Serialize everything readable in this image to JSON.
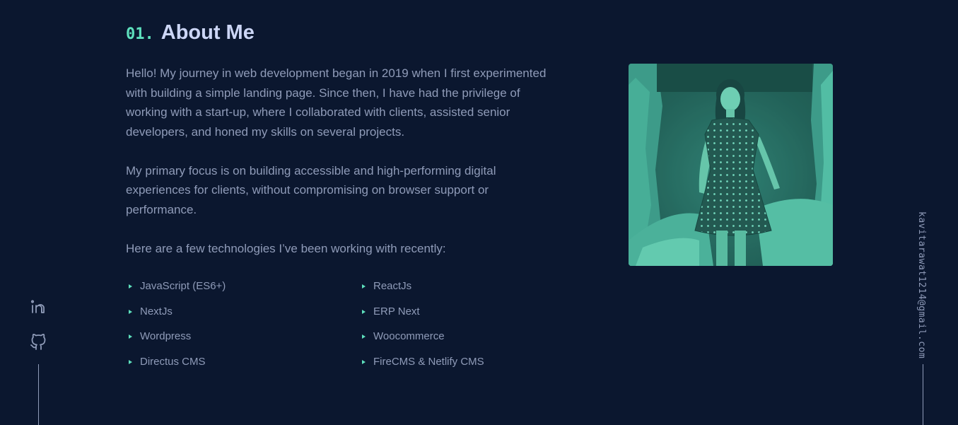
{
  "about": {
    "number": "01.",
    "title": "About Me",
    "paragraphs": [
      "Hello! My journey in web development began in 2019 when I first experimented with building a simple landing page. Since then, I have had the privilege of working with a start-up, where I collaborated with clients, assisted senior developers, and honed my skills on several projects.",
      "My primary focus is on building accessible and high-performing digital experiences for clients, without compromising on browser support or performance.",
      "Here are a few technologies I’ve been working with recently:"
    ],
    "technologies": [
      "JavaScript (ES6+)",
      "ReactJs",
      "NextJs",
      "ERP Next",
      "Wordpress",
      "Woocommerce",
      "Directus CMS",
      "FireCMS & Netlify CMS"
    ]
  },
  "social": {
    "icons": [
      "linkedin-icon",
      "github-icon"
    ]
  },
  "email": {
    "address": "kavitarawat1214@gmail.com"
  },
  "colors": {
    "background": "#0b172f",
    "accent": "#5ee0bd",
    "heading": "#ccd6f6",
    "text": "#8f9bb8"
  }
}
